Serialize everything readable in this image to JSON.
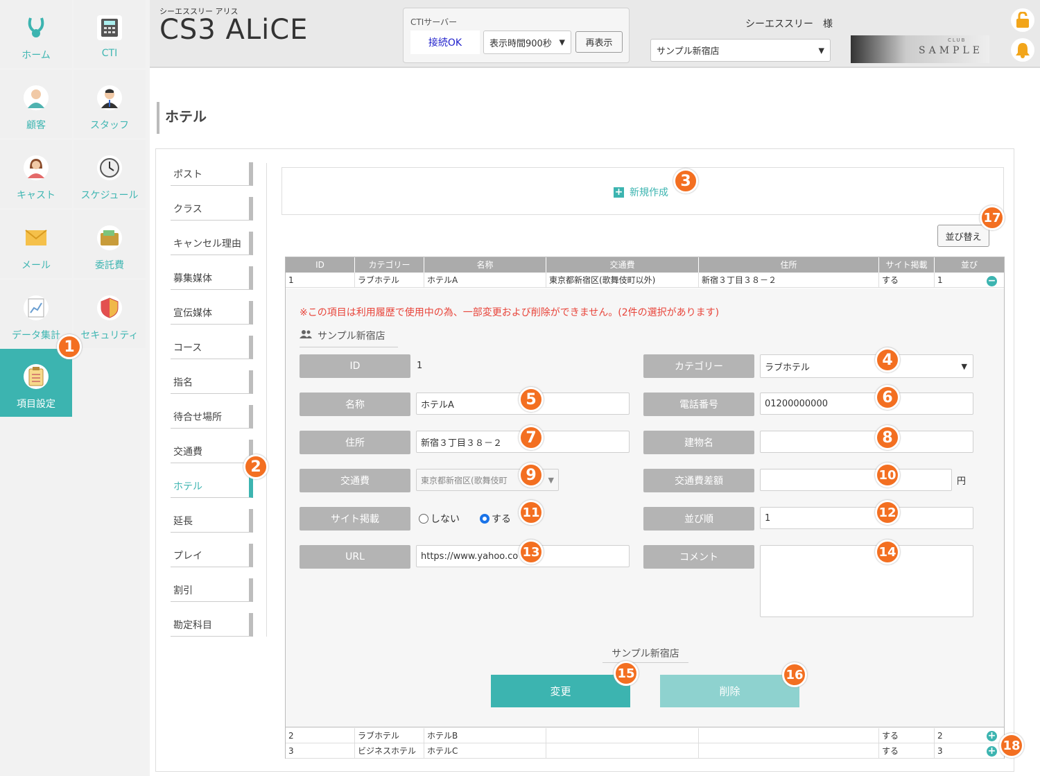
{
  "sidebar": {
    "items": [
      {
        "label": "ホーム",
        "icon": "rabbit-logo-icon"
      },
      {
        "label": "CTI",
        "icon": "phone-icon"
      },
      {
        "label": "顧客",
        "icon": "customer-icon"
      },
      {
        "label": "スタッフ",
        "icon": "staff-icon"
      },
      {
        "label": "キャスト",
        "icon": "cast-icon"
      },
      {
        "label": "スケジュール",
        "icon": "clock-icon"
      },
      {
        "label": "メール",
        "icon": "mail-icon"
      },
      {
        "label": "委託費",
        "icon": "wallet-icon"
      },
      {
        "label": "データ集計",
        "icon": "chart-icon"
      },
      {
        "label": "セキュリティ",
        "icon": "shield-icon"
      },
      {
        "label": "項目設定",
        "icon": "clipboard-icon"
      }
    ]
  },
  "header": {
    "subtitle": "シーエススリー アリス",
    "title": "CS3 ALiCE",
    "cti_label": "CTIサーバー",
    "cti_status": "接続OK",
    "display_time": "表示時間900秒",
    "refresh_label": "再表示",
    "user": "シーエススリー　様",
    "store": "サンプル新宿店",
    "banner_top": "CLUB",
    "banner_text": "SAMPLE"
  },
  "page": {
    "title": "ホテル"
  },
  "menu": {
    "items": [
      "ポスト",
      "クラス",
      "キャンセル理由",
      "募集媒体",
      "宣伝媒体",
      "コース",
      "指名",
      "待合せ場所",
      "交通費",
      "ホテル",
      "延長",
      "プレイ",
      "割引",
      "勘定科目"
    ],
    "active": "ホテル"
  },
  "new_create": "新規作成",
  "sort_button": "並び替え",
  "table": {
    "headers": [
      "ID",
      "カテゴリー",
      "名称",
      "交通費",
      "住所",
      "サイト掲載",
      "並び"
    ],
    "rows": [
      [
        "1",
        "ラブホテル",
        "ホテルA",
        "東京都新宿区(歌舞伎町以外)",
        "新宿３丁目３８－２",
        "する",
        "1"
      ],
      [
        "2",
        "ラブホテル",
        "ホテルB",
        "",
        "",
        "する",
        "2"
      ],
      [
        "3",
        "ビジネスホテル",
        "ホテルC",
        "",
        "",
        "する",
        "3"
      ]
    ]
  },
  "detail": {
    "warning": "※この項目は利用履歴で使用中の為、一部変更および削除ができません。(2件の選択があります)",
    "store": "サンプル新宿店",
    "labels": {
      "id": "ID",
      "category": "カテゴリー",
      "name": "名称",
      "phone": "電話番号",
      "address": "住所",
      "building": "建物名",
      "fare": "交通費",
      "fare_diff": "交通費差額",
      "site": "サイト掲載",
      "order": "並び順",
      "url": "URL",
      "comment": "コメント"
    },
    "values": {
      "id": "1",
      "category": "ラブホテル",
      "name": "ホテルA",
      "phone": "01200000000",
      "address": "新宿３丁目３８－２",
      "building": "",
      "fare": "東京都新宿区(歌舞伎町",
      "fare_diff": "",
      "yen": "円",
      "order": "1",
      "url": "https://www.yahoo.co",
      "comment": ""
    },
    "radio_no": "しない",
    "radio_yes": "する",
    "footer_store": "サンプル新宿店",
    "change_button": "変更",
    "delete_button": "削除"
  },
  "badges": [
    "1",
    "2",
    "3",
    "4",
    "5",
    "6",
    "7",
    "8",
    "9",
    "10",
    "11",
    "12",
    "13",
    "14",
    "15",
    "16",
    "17",
    "18"
  ],
  "colors": {
    "accent": "#3cb4b0",
    "badge": "#f36f21",
    "warning": "#e8443a"
  }
}
